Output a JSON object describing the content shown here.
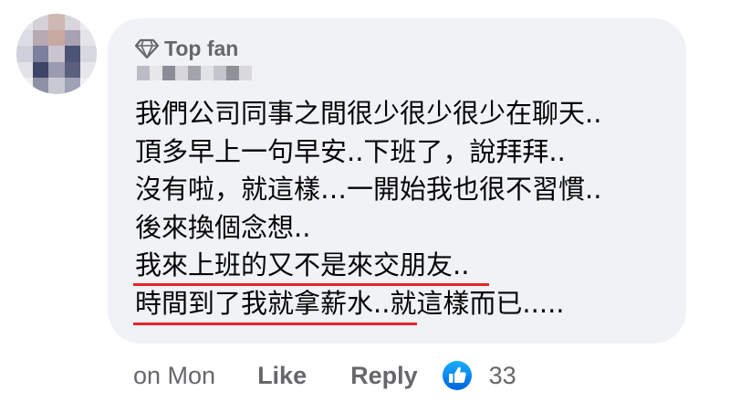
{
  "comment": {
    "badge": "Top fan",
    "badge_icon": "diamond-icon",
    "lines": [
      "我們公司同事之間很少很少很少在聊天..",
      "頂多早上一句早安..下班了，說拜拜..",
      "沒有啦，就這樣…一開始我也很不習慣..",
      "後來換個念想..",
      "我來上班的又不是來交朋友..",
      "時間到了我就拿薪水..就這樣而已....."
    ],
    "underline_color": "#e8232b"
  },
  "actions": {
    "timestamp": "on Mon",
    "like_label": "Like",
    "reply_label": "Reply",
    "reaction_icon": "like-thumb-icon",
    "reaction_count": "33"
  },
  "colors": {
    "bubble": "#f0f2f5",
    "text": "#050505",
    "secondary_text": "#65676b",
    "like_blue": "#1877f2"
  }
}
